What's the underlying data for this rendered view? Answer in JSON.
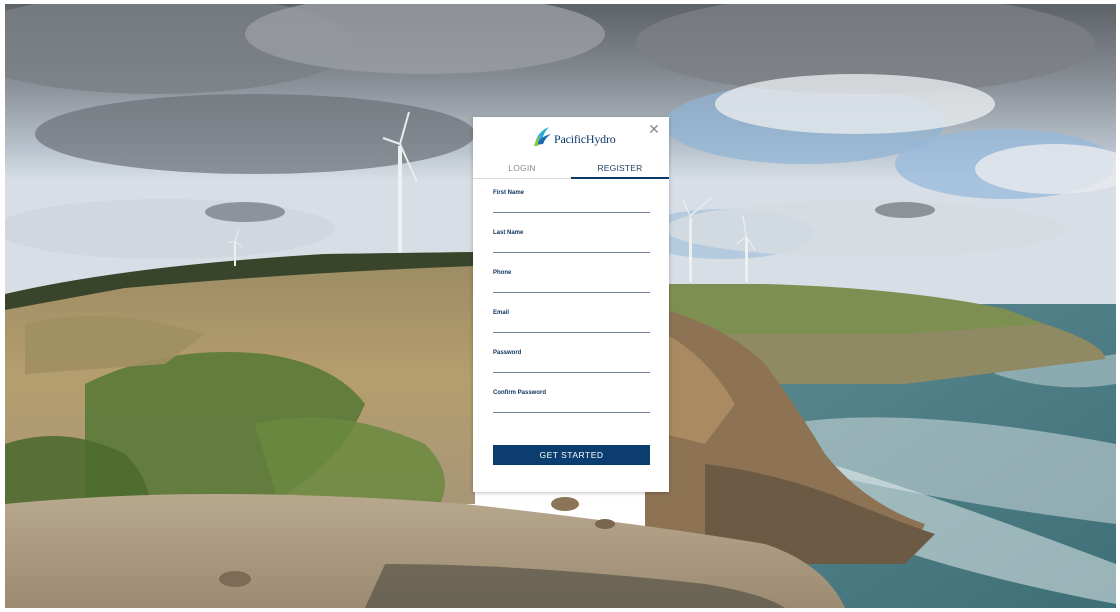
{
  "brand": {
    "name": "PacificHydro",
    "accent_color": "#0b3e6f",
    "logo_colors": [
      "#2aa8d8",
      "#1c6bb0",
      "#8cc63f"
    ]
  },
  "modal": {
    "close_icon": "close-icon",
    "close_glyph": "✕"
  },
  "tabs": [
    {
      "label": "LOGIN",
      "active": false
    },
    {
      "label": "REGISTER",
      "active": true
    }
  ],
  "form": {
    "fields": [
      {
        "label": "First Name",
        "value": "",
        "type": "text"
      },
      {
        "label": "Last Name",
        "value": "",
        "type": "text"
      },
      {
        "label": "Phone",
        "value": "",
        "type": "tel"
      },
      {
        "label": "Email",
        "value": "",
        "type": "email"
      },
      {
        "label": "Password",
        "value": "",
        "type": "password"
      },
      {
        "label": "Confirm Password",
        "value": "",
        "type": "password"
      }
    ],
    "submit_label": "GET STARTED"
  },
  "background": {
    "description_icon": "coastal-wind-farm-photo"
  }
}
